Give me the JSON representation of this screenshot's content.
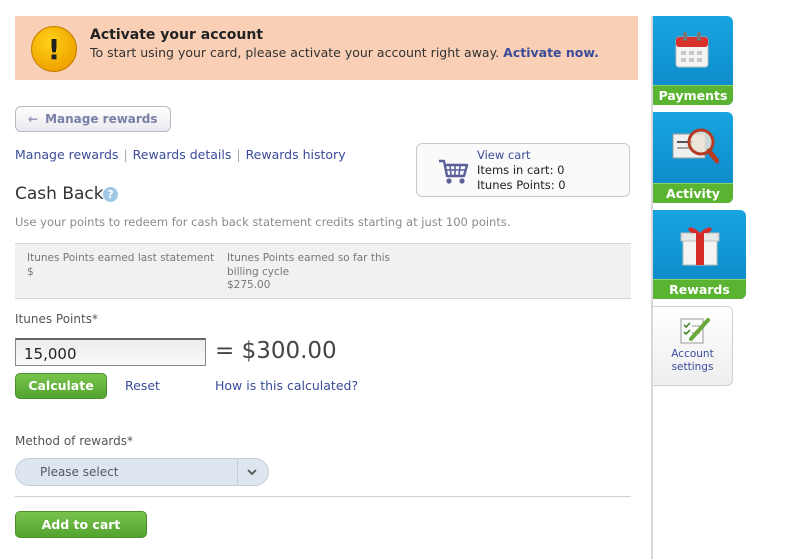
{
  "alert": {
    "title": "Activate your account",
    "text": "To start using your card, please activate your account right away.",
    "link": "Activate now."
  },
  "back_button": "Manage rewards",
  "subnav": [
    "Manage rewards",
    "Rewards details",
    "Rewards history"
  ],
  "cart": {
    "view": "View cart",
    "items": "Items in cart: 0",
    "points": "Itunes Points: 0"
  },
  "heading": "Cash Back",
  "description": "Use your points to redeem for cash back statement credits starting at just 100 points.",
  "summary": {
    "last_label": "Itunes Points earned last statement",
    "last_value": "$",
    "current_label": "Itunes Points earned so far this billing cycle",
    "current_value": "$275.00"
  },
  "points_label": "Itunes Points*",
  "points_value": "15,000",
  "equals_text": "= $300.00",
  "calculate_label": "Calculate",
  "reset_label": "Reset",
  "how_label": "How is this calculated?",
  "method_label": "Method of rewards*",
  "method_placeholder": "Please select",
  "add_to_cart_label": "Add to cart",
  "sidebar": {
    "payments": "Payments",
    "activity": "Activity",
    "rewards": "Rewards",
    "settings_line1": "Account",
    "settings_line2": "settings"
  },
  "colors": {
    "alert_bg": "#f9cfb5",
    "link": "#3a4c9a",
    "green": "#5bb431",
    "blue_tab": "#17a4e0"
  }
}
